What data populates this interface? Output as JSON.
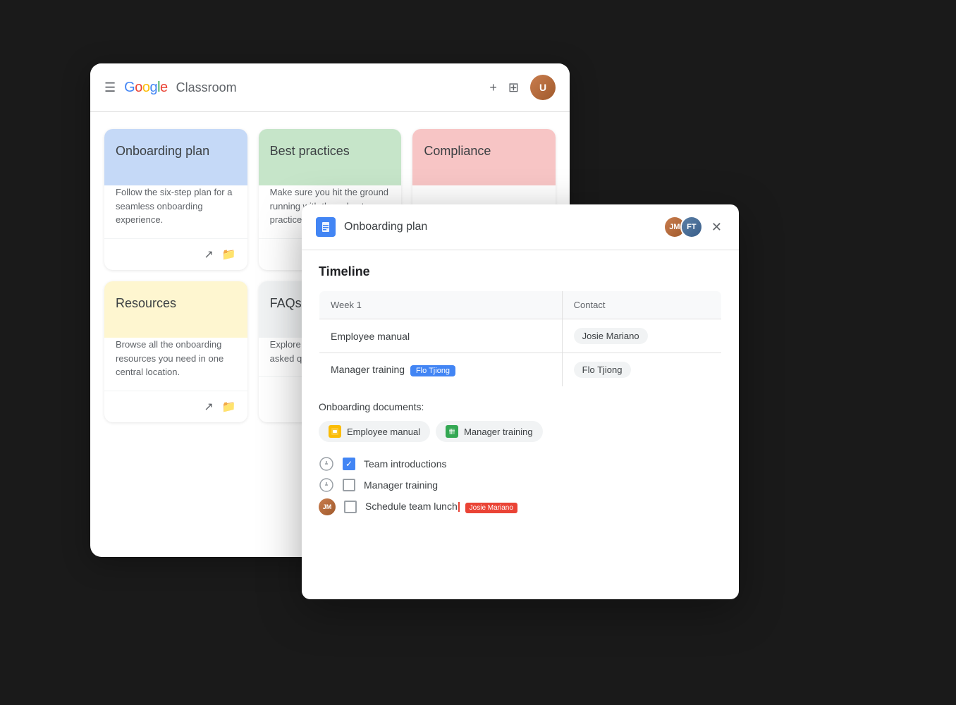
{
  "app": {
    "name": "Classroom",
    "logo": "Google"
  },
  "bg_window": {
    "cards": [
      {
        "id": "onboarding-plan",
        "title": "Onboarding plan",
        "description": "Follow the six-step plan for a seamless onboarding experience.",
        "color": "blue"
      },
      {
        "id": "best-practices",
        "title": "Best practices",
        "description": "Make sure you hit the ground running with these best practices.",
        "color": "green"
      },
      {
        "id": "compliance",
        "title": "Compliance",
        "description": "",
        "color": "red"
      },
      {
        "id": "resources",
        "title": "Resources",
        "description": "Browse all the onboarding resources you need in one central location.",
        "color": "yellow"
      },
      {
        "id": "faqs",
        "title": "FAQs",
        "description": "Explore these frequently asked questions.",
        "color": "gray"
      }
    ]
  },
  "fg_window": {
    "title": "Onboarding plan",
    "section_timeline": "Timeline",
    "table": {
      "headers": [
        "Week 1",
        "Contact"
      ],
      "rows": [
        {
          "week_item": "Employee manual",
          "contact": "Josie Mariano",
          "cursor": null
        },
        {
          "week_item": "Manager training",
          "contact": "Flo Tjiong",
          "cursor": "Flo Tjiong"
        }
      ]
    },
    "docs_label": "Onboarding documents:",
    "docs": [
      {
        "name": "Employee manual",
        "icon_type": "slides"
      },
      {
        "name": "Manager training",
        "icon_type": "sheets"
      }
    ],
    "tasks": [
      {
        "label": "Team introductions",
        "checked": true,
        "cursor": null,
        "has_avatar": false
      },
      {
        "label": "Manager training",
        "checked": false,
        "cursor": null,
        "has_avatar": false
      },
      {
        "label": "Schedule team lunch",
        "checked": false,
        "cursor": "Josie Mariano",
        "has_avatar": true
      }
    ]
  },
  "icons": {
    "hamburger": "☰",
    "plus": "+",
    "grid": "⊞",
    "close": "✕",
    "trend": "↗",
    "folder": "⬜",
    "check": "✓",
    "doc_lines": "≡"
  }
}
